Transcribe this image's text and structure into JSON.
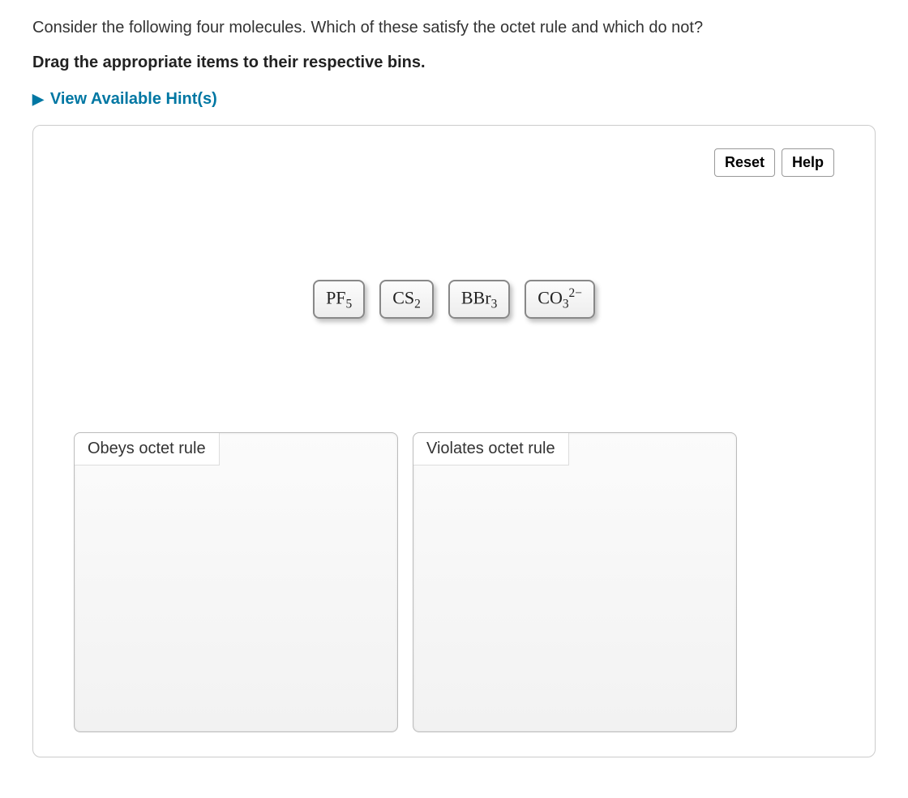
{
  "question": "Consider the following four molecules. Which of these satisfy the octet rule and which do not?",
  "instruction": "Drag the appropriate items to their respective bins.",
  "hints_label": "View Available Hint(s)",
  "toolbar": {
    "reset_label": "Reset",
    "help_label": "Help"
  },
  "molecules": [
    {
      "base": "PF",
      "sub": "5",
      "sup": ""
    },
    {
      "base": "CS",
      "sub": "2",
      "sup": ""
    },
    {
      "base": "BBr",
      "sub": "3",
      "sup": ""
    },
    {
      "base": "CO",
      "sub": "3",
      "sup": "2−"
    }
  ],
  "bins": {
    "obeys": "Obeys octet rule",
    "violates": "Violates octet rule"
  }
}
